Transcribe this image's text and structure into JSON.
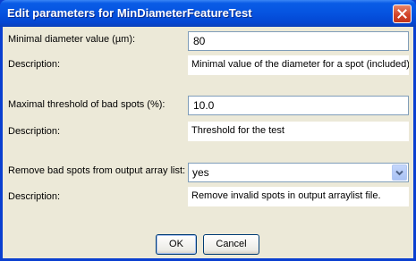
{
  "window": {
    "title": "Edit parameters for MinDiameterFeatureTest"
  },
  "params": [
    {
      "label": "Minimal diameter value (µm):",
      "value": "80",
      "desc_label": "Description:",
      "description": "Minimal value of the diameter for a spot (included)"
    },
    {
      "label": "Maximal threshold of bad spots (%):",
      "value": "10.0",
      "desc_label": "Description:",
      "description": "Threshold for the test"
    },
    {
      "label": "Remove bad spots from output array list:",
      "value": "yes",
      "desc_label": "Description:",
      "description": "Remove invalid spots in output arraylist file."
    }
  ],
  "buttons": {
    "ok": "OK",
    "cancel": "Cancel"
  },
  "icons": {
    "close": "close-icon",
    "dropdown": "chevron-down-icon"
  }
}
